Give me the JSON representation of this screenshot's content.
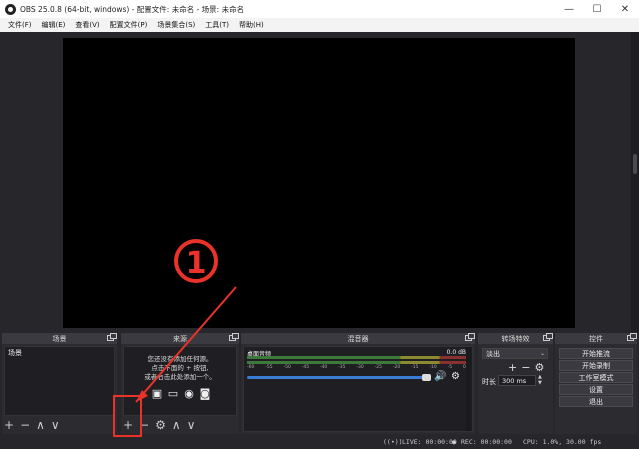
{
  "window": {
    "title": "OBS 25.0.8 (64-bit, windows) - 配置文件: 未命名 - 场景: 未命名",
    "minimize": "—",
    "maximize": "☐",
    "close": "✕"
  },
  "menu": [
    "文件(F)",
    "编辑(E)",
    "查看(V)",
    "配置文件(P)",
    "场景集合(S)",
    "工具(T)",
    "帮助(H)"
  ],
  "docks": {
    "scenes": {
      "title": "场景",
      "items": [
        "场景"
      ]
    },
    "sources": {
      "title": "来源",
      "empty_text": [
        "您还没有添加任何源。",
        "点击下面的 + 按钮,",
        "或者右击此处添加一个。"
      ]
    },
    "mixer": {
      "title": "混音器",
      "track": "桌面音频",
      "db": "0.0 dB",
      "ticks": [
        "-60",
        "-55",
        "-50",
        "-45",
        "-40",
        "-35",
        "-30",
        "-25",
        "-20",
        "-15",
        "-10",
        "-5",
        "0"
      ]
    },
    "transitions": {
      "title": "转场特效",
      "selected": "淡出",
      "duration_label": "时长",
      "duration_value": "300 ms"
    },
    "controls": {
      "title": "控件",
      "buttons": [
        "开始推流",
        "开始录制",
        "工作室模式",
        "设置",
        "退出"
      ]
    }
  },
  "status": {
    "live": "LIVE: 00:00:00",
    "rec": "REC: 00:00:00",
    "cpu": "CPU: 1.0%, 30.00 fps"
  },
  "annotation": {
    "marker": "①",
    "color": "#e8322a"
  }
}
